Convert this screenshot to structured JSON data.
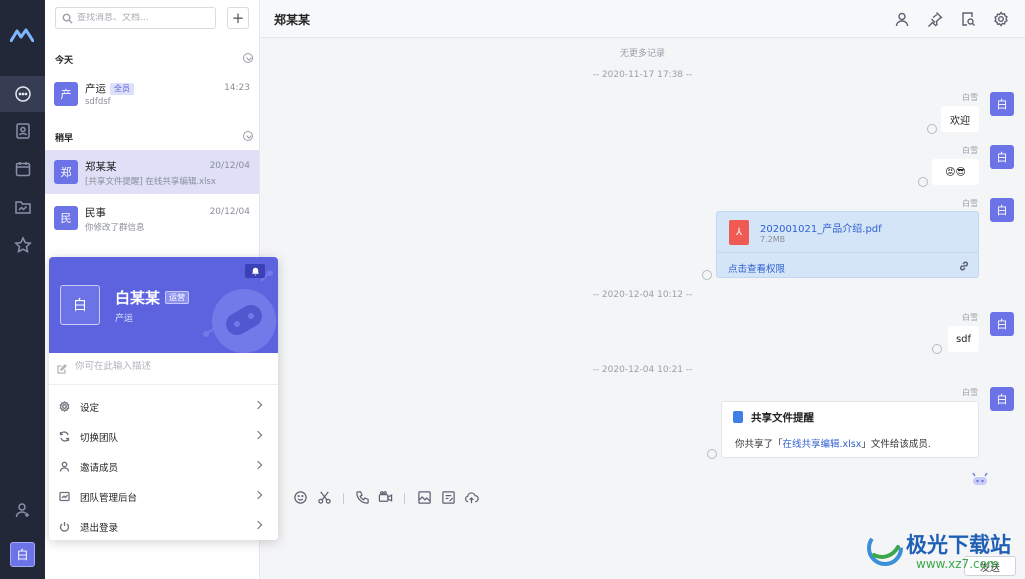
{
  "search": {
    "placeholder": "查找消息、文档..."
  },
  "add_button": "+",
  "sections": {
    "today": "今天",
    "earlier": "稍早"
  },
  "conversations": [
    {
      "avatar": "产",
      "name": "产运",
      "tag": "全员",
      "time": "14:23",
      "preview": "sdfdsf"
    },
    {
      "avatar": "郑",
      "name": "郑某某",
      "time": "20/12/04",
      "preview": "[共享文件提醒] 在线共享编辑.xlsx"
    },
    {
      "avatar": "民",
      "name": "民事",
      "time": "20/12/04",
      "preview": "你修改了群信息"
    }
  ],
  "rail": {
    "me_avatar": "白"
  },
  "chat": {
    "title": "郑某某",
    "no_more": "无更多记录",
    "timestamps": [
      "-- 2020-11-17 17:38 --",
      "-- 2020-12-04 10:12 --",
      "-- 2020-12-04 10:21 --"
    ],
    "sender": "白雪",
    "avatar": "白",
    "messages": [
      "欢迎",
      "😡😎",
      "sdf"
    ],
    "file": {
      "name": "202001021_产品介绍.pdf",
      "size": "7.2MB",
      "permission": "点击查看权限"
    },
    "share": {
      "title": "共享文件提醒",
      "prefix": "你共享了「",
      "file": "在线共享编辑.xlsx",
      "suffix": "」文件给该成员."
    },
    "send_label": "发送"
  },
  "profile": {
    "avatar": "白",
    "name": "白某某",
    "role": "运营",
    "team": "产运",
    "desc_placeholder": "你可在此输入描述",
    "menu": [
      "设定",
      "切换团队",
      "邀请成员",
      "团队管理后台",
      "退出登录"
    ]
  },
  "watermark": {
    "text": "极光下载站",
    "url": "www.xz7.com"
  },
  "colors": {
    "accent": "#6c73e6",
    "rail": "#232839",
    "file_card": "#d5e5f8",
    "link": "#2f5fd0"
  }
}
